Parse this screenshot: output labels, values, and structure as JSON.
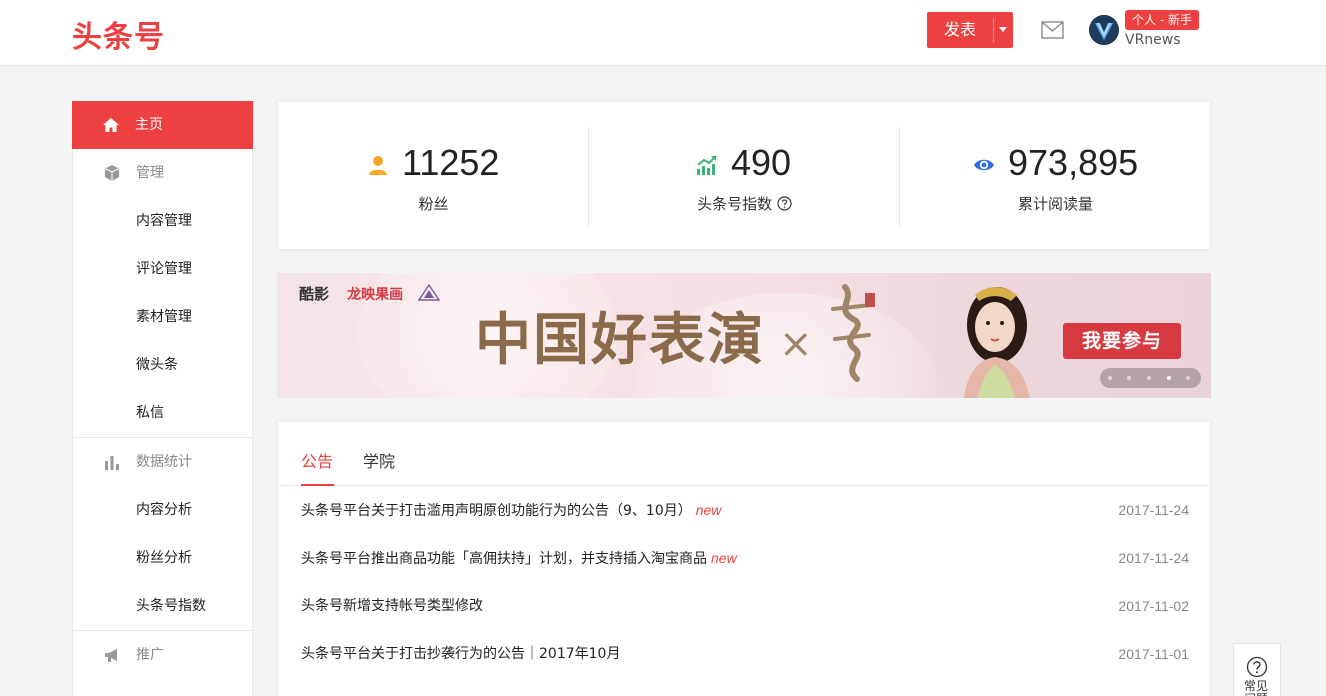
{
  "header": {
    "logo": "头条号",
    "publish_label": "发表",
    "user_badge": "个人 - 新手",
    "username": "VRnews"
  },
  "sidebar": {
    "items": [
      {
        "label": "主页",
        "icon": "home-icon",
        "active": true,
        "type": "group"
      },
      {
        "label": "管理",
        "icon": "cube-icon",
        "type": "group"
      },
      {
        "label": "内容管理",
        "type": "sub"
      },
      {
        "label": "评论管理",
        "type": "sub"
      },
      {
        "label": "素材管理",
        "type": "sub"
      },
      {
        "label": "微头条",
        "type": "sub"
      },
      {
        "label": "私信",
        "type": "sub"
      },
      {
        "label": "数据统计",
        "icon": "bar-chart-icon",
        "type": "group"
      },
      {
        "label": "内容分析",
        "type": "sub"
      },
      {
        "label": "粉丝分析",
        "type": "sub"
      },
      {
        "label": "头条号指数",
        "type": "sub"
      },
      {
        "label": "推广",
        "icon": "megaphone-icon",
        "type": "group"
      }
    ]
  },
  "stats": {
    "fans": {
      "value": "11252",
      "label": "粉丝"
    },
    "index": {
      "value": "490",
      "label": "头条号指数"
    },
    "reads": {
      "value": "973,895",
      "label": "累计阅读量"
    }
  },
  "banner": {
    "title": "中国好表演",
    "join_label": "我要参与",
    "logo_a": "酷影",
    "logo_b": "龙映果画"
  },
  "notices": {
    "tabs": [
      "公告",
      "学院"
    ],
    "items": [
      {
        "title": "头条号平台关于打击滥用声明原创功能行为的公告（9、10月）",
        "new": "new",
        "date": "2017-11-24"
      },
      {
        "title": "头条号平台推出商品功能「高佣扶持」计划，并支持插入淘宝商品",
        "new": "new",
        "date": "2017-11-24"
      },
      {
        "title": "头条号新增支持帐号类型修改",
        "new": "",
        "date": "2017-11-02"
      },
      {
        "title": "头条号平台关于打击抄袭行为的公告｜2017年10月",
        "new": "",
        "date": "2017-11-01"
      }
    ]
  },
  "faq": {
    "label": "常见问题"
  },
  "colors": {
    "brand": "#ed4040",
    "fans_icon": "#f5a623",
    "index_icon": "#3cb371",
    "reads_icon": "#2f6fe0"
  }
}
